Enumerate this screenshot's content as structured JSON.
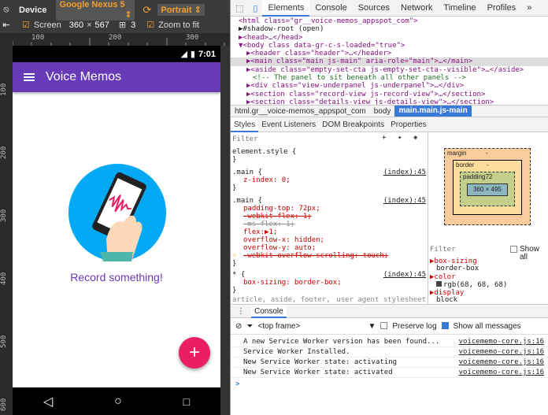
{
  "device_toolbar": {
    "device_label": "Device",
    "device_value": "Google Nexus 5",
    "orientation_value": "Portrait",
    "screen_label": "Screen",
    "screen_width": "360",
    "screen_x": "×",
    "screen_height": "567",
    "ratio_value": "3",
    "zoom_label": "Zoom to fit"
  },
  "ruler": {
    "top_ticks": [
      "100",
      "200",
      "300"
    ],
    "left_ticks": [
      "100",
      "200",
      "300",
      "400",
      "500",
      "600"
    ]
  },
  "phone": {
    "time": "7:01",
    "app_title": "Voice Memos",
    "empty_text": "Record something!",
    "fab_symbol": "+",
    "colors": {
      "appbar": "#673ab7",
      "fab": "#e91e63",
      "circle": "#03a9f4",
      "empty_text": "#673ab7"
    }
  },
  "devtools": {
    "tabs": [
      "Elements",
      "Console",
      "Sources",
      "Network",
      "Timeline",
      "Profiles",
      "»"
    ],
    "dom": [
      {
        "text": "<html class=\"gr__voice-memos_appspot_com\">"
      },
      {
        "text": "▶#shadow-root (open)"
      },
      {
        "text": "▶<head>…</head>"
      },
      {
        "text": "▼<body class data-gr-c-s-loaded=\"true\">"
      },
      {
        "text": "▶<header class=\"header\">…</header>"
      },
      {
        "text": "▶<main class=\"main js-main\" aria-role=\"main\">…</main>"
      },
      {
        "text": "▶<aside class=\"empty-set-cta js-empty-set-cta--visible\">…</aside>"
      },
      {
        "text": "<!-- The panel to sit beneath all other panels -->"
      },
      {
        "text": "▶<div class=\"view-underpanel js-underpanel\">…</div>"
      },
      {
        "text": "▶<section class=\"record-view js-record-view\">…</section>"
      },
      {
        "text": "▶<section class=\"details-view js-details-view\">…</section>"
      }
    ],
    "breadcrumbs": [
      "html.gr__voice-memos_appspot_com",
      "body",
      "main.main.js-main"
    ],
    "sub_tabs": [
      "Styles",
      "Event Listeners",
      "DOM Breakpoints",
      "Properties"
    ],
    "filter_placeholder": "Filter",
    "styles": {
      "element_style": "element.style {",
      "close": "}",
      "rule1_selector": ".main {",
      "rule1_source": "(index):45",
      "rule1_prop": "z-index: 0;",
      "rule2_selector": ".main {",
      "rule2_source": "(index):45",
      "rule2_props": [
        {
          "text": "padding-top: 72px;",
          "struck": false
        },
        {
          "text": "-webkit-flex: 1;",
          "struck": true
        },
        {
          "text": "-ms-flex: 1;",
          "struck": true
        },
        {
          "text": "flex:▶1;",
          "struck": false
        },
        {
          "text": "overflow-x: hidden;",
          "struck": false
        },
        {
          "text": "overflow-y: auto;",
          "struck": false
        },
        {
          "text": "-webkit-overflow-scrolling: touch;",
          "struck": true
        }
      ],
      "rule3_selector": "* {",
      "rule3_source": "(index):45",
      "rule3_prop": "box-sizing: border-box;",
      "ua_selector": "article, aside, footer,",
      "ua_source": "user agent stylesheet"
    },
    "metrics": {
      "margin_label": "margin",
      "border_label": "border",
      "padding_label": "padding72",
      "content_size": "360 × 495",
      "dash": "-"
    },
    "computed": {
      "filter_placeholder": "Filter",
      "show_all_label": "Show all",
      "rows": [
        {
          "prop": "box-sizing",
          "value": "border-box"
        },
        {
          "prop": "color",
          "value": "rgb(68, 68, 68)"
        },
        {
          "prop": "display",
          "value": "block"
        }
      ]
    },
    "console": {
      "tab_label": "Console",
      "frame_label": "<top frame>",
      "preserve_log_label": "Preserve log",
      "show_all_label": "Show all messages",
      "messages": [
        {
          "text": "A new Service Worker version has been found...",
          "source": "voicememo-core.js:16"
        },
        {
          "text": "Service Worker Installed.",
          "source": "voicememo-core.js:16"
        },
        {
          "text": "New Service Worker state:  activating",
          "source": "voicememo-core.js:16"
        },
        {
          "text": "New Service Worker state:  activated",
          "source": "voicememo-core.js:16"
        }
      ],
      "prompt": ">"
    }
  }
}
